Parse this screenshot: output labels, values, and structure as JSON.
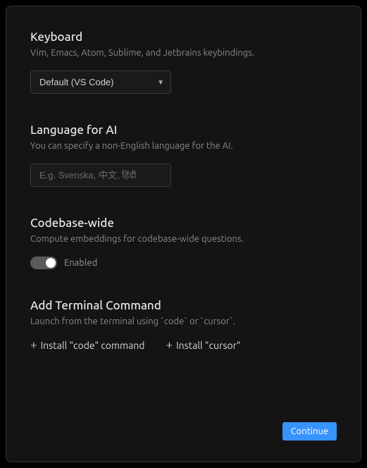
{
  "keyboard": {
    "title": "Keyboard",
    "desc": "Vim, Emacs, Atom, Sublime, and Jetbrains keybindings.",
    "selected": "Default (VS Code)"
  },
  "language": {
    "title": "Language for AI",
    "desc": "You can specify a non-English language for the AI.",
    "placeholder": "E.g. Svenska, 中文, हिंदी",
    "value": ""
  },
  "codebase": {
    "title": "Codebase-wide",
    "desc": "Compute embeddings for codebase-wide questions.",
    "toggle_label": "Enabled",
    "enabled": true
  },
  "terminal": {
    "title": "Add Terminal Command",
    "desc": "Launch from the terminal using `code` or `cursor`.",
    "install_code": "Install \"code\" command",
    "install_cursor": "Install \"cursor\""
  },
  "footer": {
    "continue": "Continue"
  }
}
